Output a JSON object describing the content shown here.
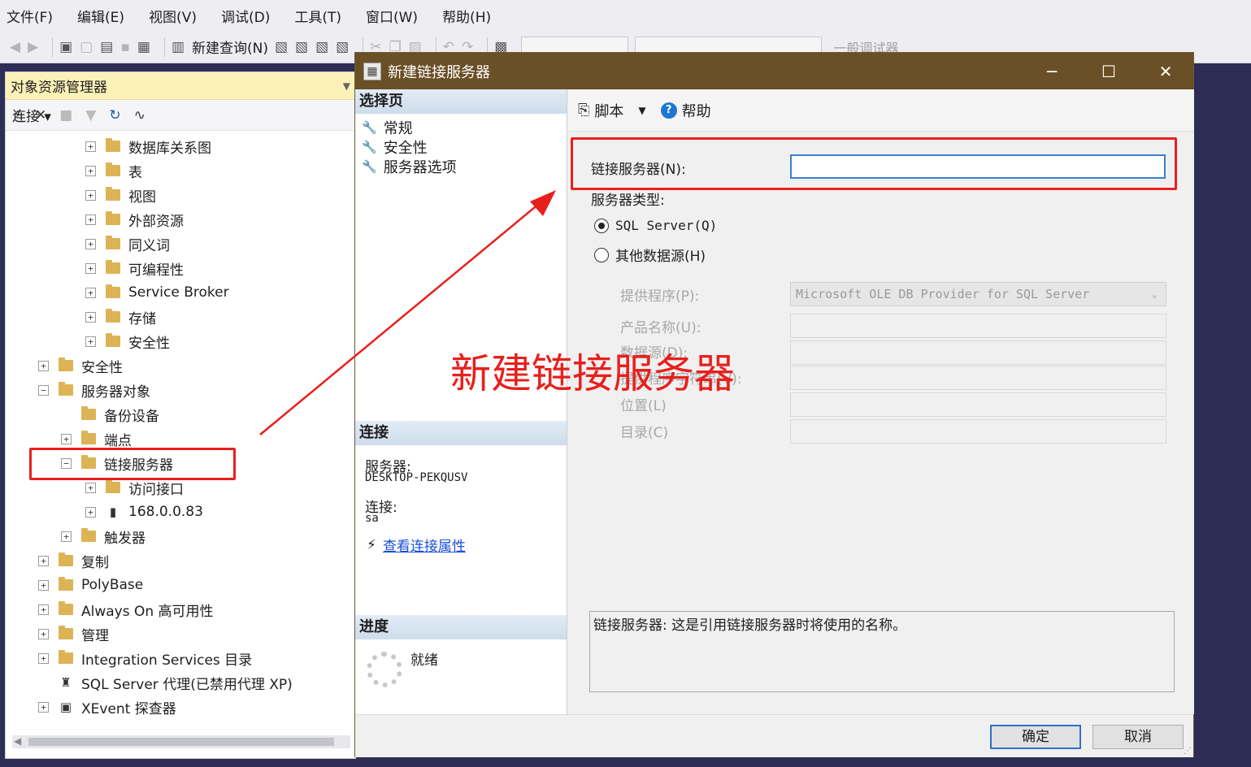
{
  "menu": [
    "文件(F)",
    "编辑(E)",
    "视图(V)",
    "调试(D)",
    "工具(T)",
    "窗口(W)",
    "帮助(H)"
  ],
  "toolbar": {
    "new_query": "新建查询(N)",
    "debugger": "一般调试器"
  },
  "object_explorer": {
    "title": "对象资源管理器",
    "connect_label": "连接",
    "tree": [
      {
        "label": "数据库关系图",
        "level": 3,
        "expander": "+",
        "icon": "folder-icon"
      },
      {
        "label": "表",
        "level": 3,
        "expander": "+",
        "icon": "folder-icon"
      },
      {
        "label": "视图",
        "level": 3,
        "expander": "+",
        "icon": "folder-icon"
      },
      {
        "label": "外部资源",
        "level": 3,
        "expander": "+",
        "icon": "folder-icon"
      },
      {
        "label": "同义词",
        "level": 3,
        "expander": "+",
        "icon": "folder-icon"
      },
      {
        "label": "可编程性",
        "level": 3,
        "expander": "+",
        "icon": "folder-icon"
      },
      {
        "label": "Service Broker",
        "level": 3,
        "expander": "+",
        "icon": "folder-icon"
      },
      {
        "label": "存储",
        "level": 3,
        "expander": "+",
        "icon": "folder-icon"
      },
      {
        "label": "安全性",
        "level": 3,
        "expander": "+",
        "icon": "folder-icon"
      },
      {
        "label": "安全性",
        "level": 1,
        "expander": "+",
        "icon": "folder-icon"
      },
      {
        "label": "服务器对象",
        "level": 1,
        "expander": "−",
        "icon": "folder-icon"
      },
      {
        "label": "备份设备",
        "level": 2,
        "expander": "",
        "icon": "folder-icon"
      },
      {
        "label": "端点",
        "level": 2,
        "expander": "+",
        "icon": "folder-icon"
      },
      {
        "label": "链接服务器",
        "level": 2,
        "expander": "−",
        "icon": "folder-icon"
      },
      {
        "label": "访问接口",
        "level": 3,
        "expander": "+",
        "icon": "folder-icon"
      },
      {
        "label": "168.0.0.83",
        "level": 3,
        "expander": "+",
        "icon": "server-icon"
      },
      {
        "label": "触发器",
        "level": 2,
        "expander": "+",
        "icon": "folder-icon"
      },
      {
        "label": "复制",
        "level": 1,
        "expander": "+",
        "icon": "folder-icon"
      },
      {
        "label": "PolyBase",
        "level": 1,
        "expander": "+",
        "icon": "folder-icon"
      },
      {
        "label": "Always On 高可用性",
        "level": 1,
        "expander": "+",
        "icon": "folder-icon"
      },
      {
        "label": "管理",
        "level": 1,
        "expander": "+",
        "icon": "folder-icon"
      },
      {
        "label": "Integration Services 目录",
        "level": 1,
        "expander": "+",
        "icon": "folder-icon"
      },
      {
        "label": "SQL Server 代理(已禁用代理 XP)",
        "level": 1,
        "expander": "",
        "icon": "agent-icon"
      },
      {
        "label": "XEvent 探查器",
        "level": 1,
        "expander": "+",
        "icon": "xevent-icon"
      }
    ]
  },
  "dialog": {
    "title": "新建链接服务器",
    "select_page_header": "选择页",
    "pages": [
      "常规",
      "安全性",
      "服务器选项"
    ],
    "connection_header": "连接",
    "server_label": "服务器:",
    "server_value": "DESKTOP-PEKQUSV",
    "connection_label": "连接:",
    "connection_value": "sa",
    "view_props_link": "查看连接属性",
    "progress_header": "进度",
    "progress_status": "就绪",
    "script_label": "脚本",
    "help_label": "帮助",
    "linked_server_label": "链接服务器(N):",
    "server_type_label": "服务器类型:",
    "radio_sql": "SQL Server(Q)",
    "radio_other": "其他数据源(H)",
    "provider_label": "提供程序(P):",
    "provider_value": "Microsoft OLE DB Provider for SQL Server",
    "product_label": "产品名称(U):",
    "datasource_label": "数据源(D):",
    "provstring_label": "提供程序字符串(V):",
    "location_label": "位置(L)",
    "catalog_label": "目录(C)",
    "description": "链接服务器: 这是引用链接服务器时将使用的名称。",
    "ok_button": "确定",
    "cancel_button": "取消"
  },
  "annotation": {
    "text": "新建链接服务器",
    "color": "#e8201c"
  }
}
